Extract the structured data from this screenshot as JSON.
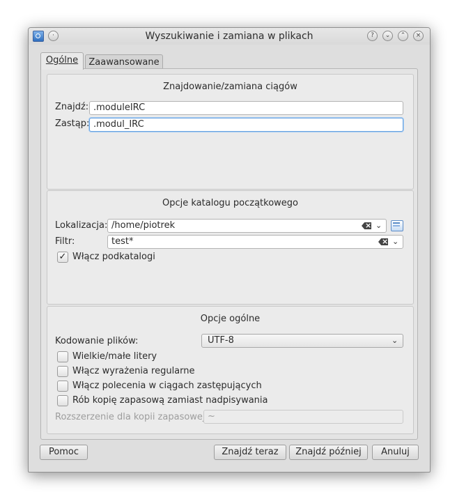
{
  "window": {
    "title": "Wyszukiwanie i zamiana w plikach",
    "buttons": {
      "help": "?",
      "shade": "⌄",
      "maximize": "⌃",
      "close": "×"
    }
  },
  "tabs": [
    {
      "label": "Ogólne",
      "active": true
    },
    {
      "label": "Zaawansowane",
      "active": false
    }
  ],
  "find_replace": {
    "title": "Znajdowanie/zamiana ciągów",
    "find_label": "Znajdź:",
    "find_value": ".moduleIRC",
    "replace_label": "Zastąp:",
    "replace_value": ".modul_IRC"
  },
  "start_dir": {
    "title": "Opcje katalogu początkowego",
    "location_label": "Lokalizacja:",
    "location_value": "/home/piotrek",
    "filter_label": "Filtr:",
    "filter_value": "test*",
    "subdirs_label": "Włącz podkatalogi",
    "subdirs_checked": true
  },
  "general": {
    "title": "Opcje ogólne",
    "encoding_label": "Kodowanie plików:",
    "encoding_value": "UTF-8",
    "options": [
      {
        "label": "Wielkie/małe litery",
        "checked": false
      },
      {
        "label": "Włącz wyrażenia regularne",
        "checked": false
      },
      {
        "label": "Włącz polecenia w ciągach zastępujących",
        "checked": false
      },
      {
        "label": "Rób kopię zapasową zamiast nadpisywania",
        "checked": false
      }
    ],
    "backup_ext_label": "Rozszerzenie dla kopii zapasowej:",
    "backup_ext_value": "~"
  },
  "footer": {
    "help": "Pomoc",
    "find_now": "Znajdź teraz",
    "find_later": "Znajdź później",
    "cancel": "Anuluj"
  },
  "icons": {
    "check_mark": "✓",
    "chevron": "⌄"
  }
}
